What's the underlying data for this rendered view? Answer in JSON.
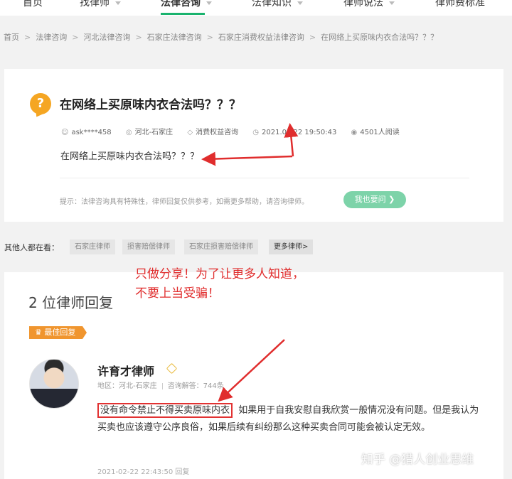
{
  "nav": {
    "items": [
      {
        "label": "首页"
      },
      {
        "label": "找律师"
      },
      {
        "label": "法律咨询"
      },
      {
        "label": "法律知识"
      },
      {
        "label": "律师说法"
      },
      {
        "label": "律师费标准"
      }
    ]
  },
  "breadcrumb": [
    "首页",
    "法律咨询",
    "河北法律咨询",
    "石家庄法律咨询",
    "石家庄消费权益法律咨询",
    "在网络上买原味内衣合法吗？？？"
  ],
  "question": {
    "title": "在网络上买原味内衣合法吗？？？",
    "user": "ask****458",
    "location": "河北-石家庄",
    "category": "消费权益咨询",
    "time": "2021.02.22 19:50:43",
    "reads": "4501人阅读",
    "body": "在网络上买原味内衣合法吗？？？",
    "tip": "提示：法律咨询具有特殊性，律师回复仅供参考，如需更多帮助，请咨询律师。",
    "ask_button": "我也要问"
  },
  "others": {
    "label": "其他人都在看：",
    "tags": [
      "石家庄律师",
      "损害赔偿律师",
      "石家庄损害赔偿律师"
    ],
    "more": "更多律师>"
  },
  "answers": {
    "heading": "2 位律师回复",
    "best_badge": "最佳回复",
    "lawyer_name": "许育才律师",
    "region": "地区：河北-石家庄",
    "answer_count": "咨询解答：744条",
    "highlight": "没有命令禁止不得买卖原味内衣",
    "text_rest": "如果用于自我安慰自我欣赏一般情况没有问题。但是我认为买卖也应该遵守公序良俗，如果后续有纠纷那么这种买卖合同可能会被认定无效。",
    "time": "2021-02-22 22:43:50 回复"
  },
  "annotation": {
    "line1": "只做分享！为了让更多人知道，",
    "line2": "不要上当受骗！"
  },
  "watermark": "知乎 @猎人创业思维",
  "colors": {
    "accent_green": "#1ab36e",
    "annotation_red": "#e02d2d",
    "badge_orange": "#f0952e"
  }
}
